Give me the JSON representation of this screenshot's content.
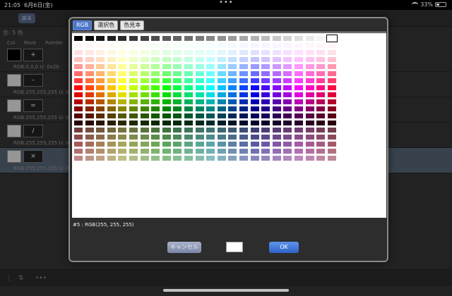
{
  "status": {
    "time": "21:05",
    "date": "6月6日(金)",
    "dots": "•••",
    "battery": "33%"
  },
  "nav": {
    "back": "戻る",
    "title": ""
  },
  "list": {
    "count": "全: 5 色",
    "headers": [
      "Col",
      "Mark",
      "Palette"
    ],
    "items": [
      {
        "swatch": "#000000",
        "mark": "+",
        "info": "RGB:0,0,0 U: 0x2b"
      },
      {
        "swatch": "#c8c8c8",
        "mark": "–",
        "info": "RGB:255,255,255 U: 0x"
      },
      {
        "swatch": "#c8c8c8",
        "mark": "=",
        "info": "RGB:255,255,255 U: 0x"
      },
      {
        "swatch": "#c8c8c8",
        "mark": "/",
        "info": "RGB:255,255,255 U: 0x"
      },
      {
        "swatch": "#c8c8c8",
        "mark": "×",
        "info": "RGB:255,255,255 U: 0x"
      }
    ]
  },
  "dialog": {
    "tabs": [
      {
        "label": "RGB",
        "active": true
      },
      {
        "label": "選択色",
        "active": false
      },
      {
        "label": "色見本",
        "active": false
      }
    ],
    "selected_info": "#5 : RGB(255, 255, 255)",
    "selected_color": "#ffffff",
    "cancel_label": "キャンセル",
    "ok_label": "OK"
  },
  "palette": {
    "columns": 24,
    "gray_row": [
      "#000000",
      "#0b0b0b",
      "#161616",
      "#212121",
      "#2c2c2c",
      "#373737",
      "#424242",
      "#4d4d4d",
      "#595959",
      "#646464",
      "#6f6f6f",
      "#7a7a7a",
      "#858585",
      "#909090",
      "#9b9b9b",
      "#a6a6a6",
      "#b2b2b2",
      "#bdbdbd",
      "#c8c8c8",
      "#d3d3d3",
      "#dedede",
      "#e9e9e9",
      "#f4f4f4",
      "#ffffff"
    ],
    "hues": [
      0,
      15,
      30,
      45,
      60,
      75,
      90,
      105,
      120,
      135,
      150,
      165,
      180,
      195,
      210,
      225,
      240,
      255,
      270,
      285,
      300,
      315,
      330,
      345
    ],
    "rows": [
      {
        "s": 100,
        "l": 98
      },
      {
        "s": 100,
        "l": 94
      },
      {
        "s": 100,
        "l": 88
      },
      {
        "s": 100,
        "l": 80
      },
      {
        "s": 100,
        "l": 71
      },
      {
        "s": 100,
        "l": 62
      },
      {
        "s": 100,
        "l": 52
      },
      {
        "s": 100,
        "l": 44
      },
      {
        "s": 100,
        "l": 35
      },
      {
        "s": 100,
        "l": 26
      },
      {
        "s": 100,
        "l": 17
      },
      {
        "s": 100,
        "l": 8
      },
      {
        "s": 30,
        "l": 35
      },
      {
        "s": 30,
        "l": 42
      },
      {
        "s": 30,
        "l": 50
      },
      {
        "s": 30,
        "l": 57
      },
      {
        "s": 30,
        "l": 64
      }
    ],
    "selected_index": 23
  }
}
